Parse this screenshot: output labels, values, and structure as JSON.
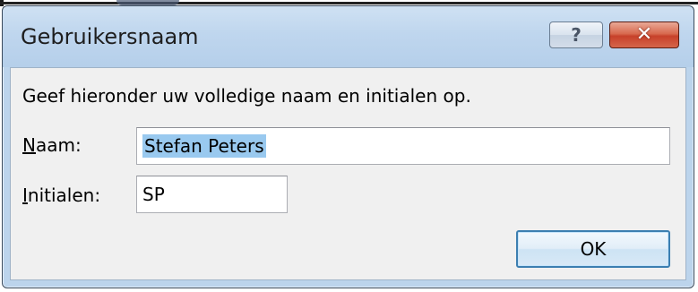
{
  "window": {
    "title": "Gebruikersnaam",
    "help_glyph": "?",
    "close_glyph": "✕"
  },
  "dialog": {
    "instruction": "Geef hieronder uw volledige naam en initialen op.",
    "name_label_mnemonic": "N",
    "name_label_rest": "aam:",
    "name_value": "Stefan Peters",
    "initials_label_mnemonic": "I",
    "initials_label_rest": "nitialen:",
    "initials_value": "SP",
    "ok_label": "OK"
  },
  "colors": {
    "titlebar": "#bfd6ee",
    "client_background": "#f0f0f0",
    "close_button": "#c7412a",
    "selection": "#99c9ef"
  },
  "icons": {
    "help": "help-icon",
    "close": "close-icon"
  }
}
